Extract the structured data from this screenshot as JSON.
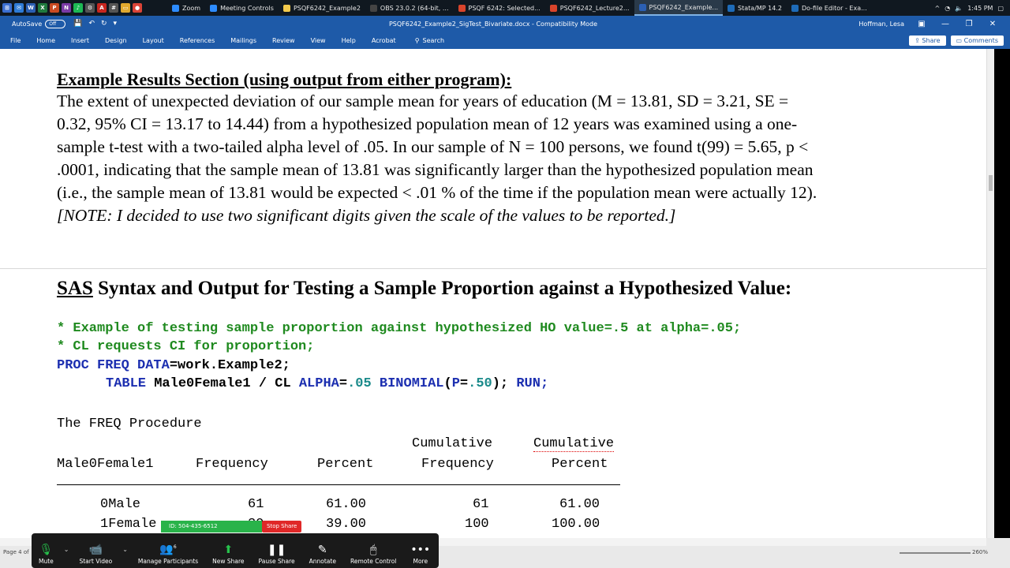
{
  "taskbar": {
    "apps": [
      {
        "label": "Zoom",
        "color": "#2d8cff",
        "active": false
      },
      {
        "label": "Meeting Controls",
        "color": "#2d8cff",
        "active": false
      },
      {
        "label": "PSQF6242_Example2",
        "color": "#f2c94c",
        "active": false
      },
      {
        "label": "OBS 23.0.2 (64-bit, ...",
        "color": "#444444",
        "active": false
      },
      {
        "label": "PSQF 6242: Selected...",
        "color": "#d9442b",
        "active": false
      },
      {
        "label": "PSQF6242_Lecture2...",
        "color": "#d9442b",
        "active": false
      },
      {
        "label": "PSQF6242_Example...",
        "color": "#2b5fb3",
        "active": true
      },
      {
        "label": "Stata/MP 14.2",
        "color": "#1e6bb8",
        "active": false
      },
      {
        "label": "Do-file Editor - Exa...",
        "color": "#1e6bb8",
        "active": false
      }
    ],
    "clock": "1:45 PM"
  },
  "titlebar": {
    "autosave_label": "AutoSave",
    "autosave_state": "Off",
    "doc_title": "PSQF6242_Example2_SigTest_Bivariate.docx  -  Compatibility Mode",
    "user": "Hoffman, Lesa"
  },
  "ribbon": {
    "tabs": [
      "File",
      "Home",
      "Insert",
      "Design",
      "Layout",
      "References",
      "Mailings",
      "Review",
      "View",
      "Help",
      "Acrobat"
    ],
    "search_label": "Search",
    "share_label": "Share",
    "comments_label": "Comments"
  },
  "document": {
    "results_heading": "Example Results Section (using output from either program):",
    "para_lines": [
      "The extent of unexpected deviation of our sample mean for years of education (M = 13.81, SD = 3.21, SE =",
      "0.32, 95% CI = 13.17 to 14.44) from a hypothesized population mean of 12 years was examined using a one-",
      "sample t-test with a two-tailed alpha level of .05. In our sample of N = 100 persons, we found t(99) = 5.65, p <",
      ".0001, indicating that the sample mean of 13.81 was significantly larger than the hypothesized population mean",
      "(i.e., the sample mean of 13.81 would be expected < .01 % of the time if the population mean were actually 12)."
    ],
    "note": "[NOTE: I decided to use two significant digits given the scale of the values to be reported.]",
    "sas_heading_prefix": "SAS",
    "sas_heading_rest": " Syntax and Output for Testing a Sample Proportion against a Hypothesized Value:",
    "code": {
      "comment1": "* Example of testing sample proportion against hypothesized HO value=.5 at alpha=.05;",
      "comment2": "* CL requests CI for proportion;",
      "proc": "PROC FREQ",
      "data_kw": "DATA",
      "data_val": "=work.Example2;",
      "table_kw": "TABLE",
      "table_var": " Male0Female1 / CL ",
      "alpha_kw": "ALPHA",
      "alpha_eq": "=",
      "alpha_val": ".05",
      "binomial_kw": "BINOMIAL",
      "p_open": "(",
      "p_kw": "P",
      "p_eq": "=",
      "p_val": ".50",
      "p_close": "); ",
      "run_kw": "RUN;"
    },
    "output": {
      "title": "The FREQ Procedure",
      "headers_top": [
        "Cumulative",
        "Cumulative"
      ],
      "headers": [
        "Male0Female1",
        "Frequency",
        "Percent",
        "Frequency",
        "Percent"
      ],
      "rows": [
        [
          "0Male",
          "61",
          "61.00",
          "61",
          "61.00"
        ],
        [
          "1Female",
          "39",
          "39.00",
          "100",
          "100.00"
        ]
      ]
    }
  },
  "status": {
    "page": "Page 4 of",
    "zoom": "260%"
  },
  "zoom_toolbar": {
    "meeting_id": "ID: 504-435-6512",
    "stop_share": "Stop Share",
    "participants_count": "6",
    "buttons": [
      "Mute",
      "Start Video",
      "Manage Participants",
      "New Share",
      "Pause Share",
      "Annotate",
      "Remote Control",
      "More"
    ]
  }
}
